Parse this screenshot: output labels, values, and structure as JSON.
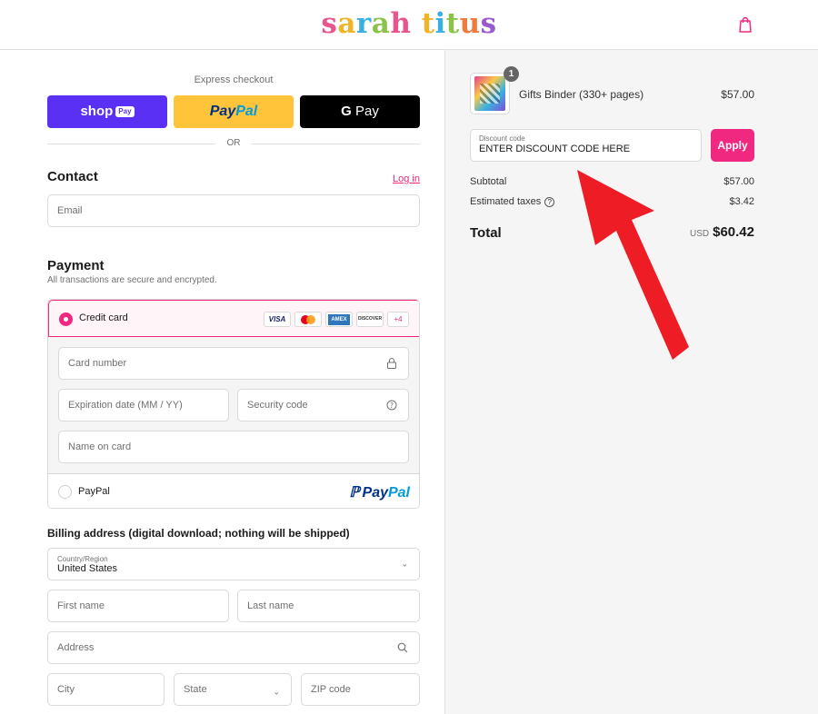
{
  "header": {
    "brand_letters": [
      {
        "ch": "s",
        "color": "#e8548c"
      },
      {
        "ch": "a",
        "color": "#f0b429"
      },
      {
        "ch": "r",
        "color": "#3ab0e2"
      },
      {
        "ch": "a",
        "color": "#8bc34a"
      },
      {
        "ch": "h",
        "color": "#e8548c"
      },
      {
        "ch": " ",
        "color": "#000000"
      },
      {
        "ch": "t",
        "color": "#f0b429"
      },
      {
        "ch": "i",
        "color": "#3ab0e2"
      },
      {
        "ch": "t",
        "color": "#8bc34a"
      },
      {
        "ch": "u",
        "color": "#f07a3c"
      },
      {
        "ch": "s",
        "color": "#9b59d0"
      }
    ],
    "cart_icon": "shopping-bag-icon"
  },
  "express": {
    "title": "Express checkout",
    "shop_pay": {
      "text": "shop",
      "tag": "Pay"
    },
    "paypal": {
      "pay": "Pay",
      "pal": "Pal"
    },
    "gpay": {
      "g": "G",
      "text": "Pay"
    },
    "or": "OR"
  },
  "contact": {
    "title": "Contact",
    "login": "Log in",
    "email_placeholder": "Email"
  },
  "payment": {
    "title": "Payment",
    "subtitle": "All transactions are secure and encrypted.",
    "credit_card_label": "Credit card",
    "card_brands": [
      "VISA",
      "MASTERCARD",
      "AMEX",
      "DISCOVER"
    ],
    "more_cards": "+4",
    "card_number": "Card number",
    "expiration": "Expiration date (MM / YY)",
    "security_code": "Security code",
    "name_on_card": "Name on card",
    "paypal_label": "PayPal",
    "paypal_logo": {
      "pay": "Pay",
      "pal": "Pal"
    }
  },
  "billing": {
    "title": "Billing address (digital download; nothing will be shipped)",
    "country_label": "Country/Region",
    "country_value": "United States",
    "first_name": "First name",
    "last_name": "Last name",
    "address": "Address",
    "city": "City",
    "state": "State",
    "zip": "ZIP code"
  },
  "order": {
    "item_name": "Gifts Binder (330+ pages)",
    "item_price": "$57.00",
    "item_qty": "1",
    "discount_label": "Discount code",
    "discount_value": "ENTER DISCOUNT CODE HERE",
    "apply": "Apply",
    "subtotal_label": "Subtotal",
    "subtotal": "$57.00",
    "taxes_label": "Estimated taxes",
    "taxes": "$3.42",
    "total_label": "Total",
    "currency": "USD",
    "total": "$60.42"
  },
  "colors": {
    "accent": "#f0287f",
    "annotation_arrow": "#ee1c25"
  }
}
